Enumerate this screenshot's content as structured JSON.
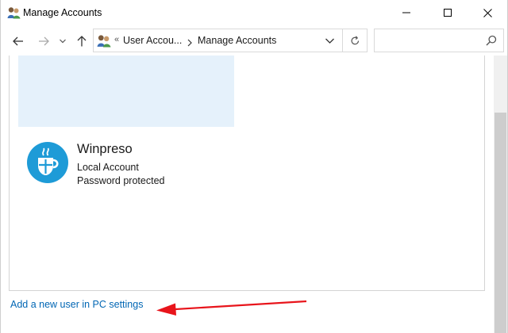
{
  "window": {
    "title": "Manage Accounts",
    "controls": {
      "minimize": "minimize",
      "maximize": "maximize",
      "close": "close"
    }
  },
  "nav": {
    "back_icon": "arrow-left-icon",
    "forward_icon": "arrow-right-icon",
    "recent_icon": "chevron-down-icon",
    "up_icon": "arrow-up-icon"
  },
  "address": {
    "overflow": "«",
    "crumbs": [
      "User Accou...",
      "Manage Accounts"
    ],
    "dropdown_icon": "chevron-down-icon",
    "refresh_icon": "refresh-icon"
  },
  "search": {
    "placeholder": "",
    "icon": "search-icon"
  },
  "accounts": [
    {
      "name": "Winpreso",
      "type": "Local Account",
      "status": "Password protected"
    }
  ],
  "links": {
    "add_user": "Add a new user in PC settings"
  },
  "colors": {
    "selection": "#e5f1fb",
    "link": "#0066b4",
    "avatar": "#1e9bd7",
    "annotation_arrow": "#e8141b"
  }
}
